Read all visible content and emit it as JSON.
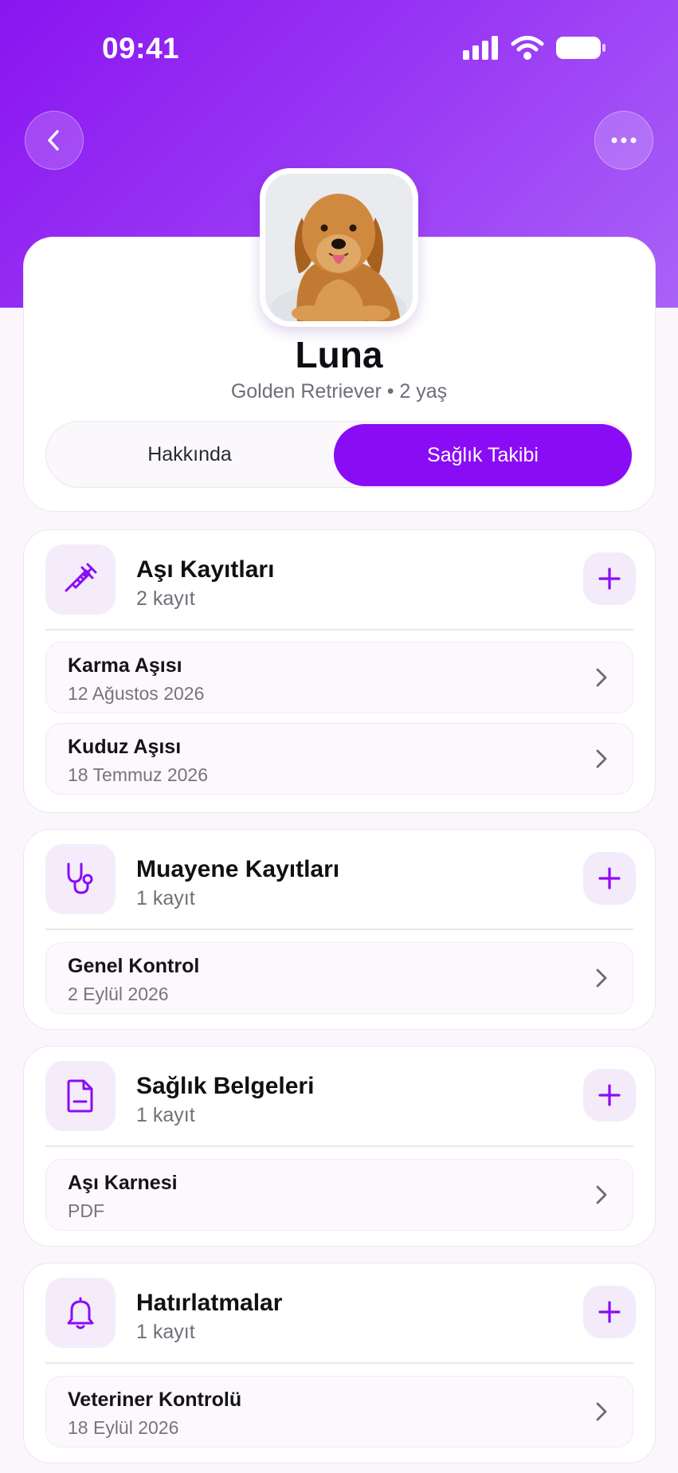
{
  "status": {
    "time": "09:41"
  },
  "colors": {
    "accent": "#8a0cf5",
    "header_gradient": [
      "#8a14f0",
      "#a962f7"
    ]
  },
  "nav": {
    "back_icon": "chevron-left-icon",
    "more_icon": "ellipsis-icon"
  },
  "profile": {
    "name": "Luna",
    "subtitle": "Golden Retriever • 2 yaş",
    "photo": "golden-retriever-photo"
  },
  "tabs": [
    {
      "label": "Hakkında",
      "active": false
    },
    {
      "label": "Sağlık Takibi",
      "active": true
    }
  ],
  "sections": [
    {
      "icon": "syringe-icon",
      "title": "Aşı Kayıtları",
      "count": "2 kayıt",
      "items": [
        {
          "title": "Karma Aşısı",
          "subtitle": "12 Ağustos 2026"
        },
        {
          "title": "Kuduz Aşısı",
          "subtitle": "18 Temmuz 2026"
        }
      ]
    },
    {
      "icon": "stethoscope-icon",
      "title": "Muayene Kayıtları",
      "count": "1 kayıt",
      "items": [
        {
          "title": "Genel Kontrol",
          "subtitle": "2 Eylül 2026"
        }
      ]
    },
    {
      "icon": "document-icon",
      "title": "Sağlık Belgeleri",
      "count": "1 kayıt",
      "items": [
        {
          "title": "Aşı Karnesi",
          "subtitle": "PDF"
        }
      ]
    },
    {
      "icon": "bell-icon",
      "title": "Hatırlatmalar",
      "count": "1 kayıt",
      "items": [
        {
          "title": "Veteriner Kontrolü",
          "subtitle": "18 Eylül 2026"
        }
      ]
    }
  ]
}
